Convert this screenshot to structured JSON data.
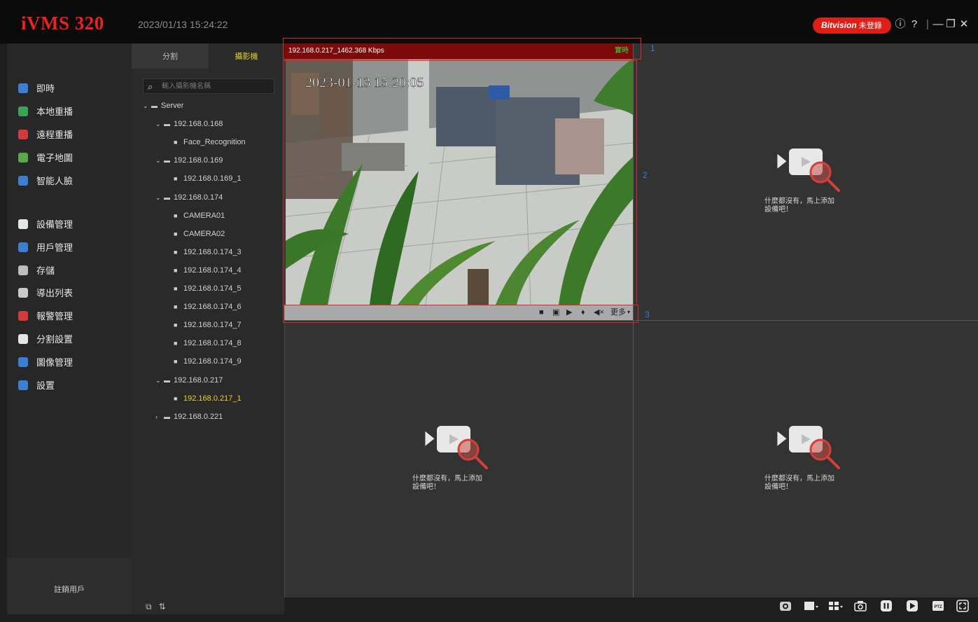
{
  "app": {
    "title": "iVMS 320",
    "datetime": "2023/01/13 15:24:22",
    "brand_badge": "Bitvision",
    "brand_status": "未登錄"
  },
  "nav": {
    "items": [
      {
        "label": "即時",
        "icon": "live-icon",
        "color": "#3c7fd0"
      },
      {
        "label": "本地重播",
        "icon": "local-playback-icon",
        "color": "#3aa35a"
      },
      {
        "label": "遠程重播",
        "icon": "remote-playback-icon",
        "color": "#d43a3a"
      },
      {
        "label": "電子地圖",
        "icon": "emap-icon",
        "color": "#5aa84a"
      },
      {
        "label": "智能人臉",
        "icon": "face-icon",
        "color": "#3c7fd0"
      },
      {
        "label": "設備管理",
        "icon": "device-icon",
        "color": "#e5e5e5"
      },
      {
        "label": "用戶管理",
        "icon": "user-icon",
        "color": "#3c7fd0"
      },
      {
        "label": "存儲",
        "icon": "storage-icon",
        "color": "#bdbdbd"
      },
      {
        "label": "導出列表",
        "icon": "export-icon",
        "color": "#c9c9c9"
      },
      {
        "label": "報警管理",
        "icon": "alarm-icon",
        "color": "#d43a3a"
      },
      {
        "label": "分割設置",
        "icon": "split-icon",
        "color": "#e5e5e5"
      },
      {
        "label": "圖像管理",
        "icon": "image-icon",
        "color": "#3c7fd0"
      },
      {
        "label": "設置",
        "icon": "settings-icon",
        "color": "#3c7fd0"
      }
    ],
    "logout": "註銷用戶"
  },
  "tree": {
    "tabs": [
      "分割",
      "攝影機"
    ],
    "search_placeholder": "輸入攝影機名稱",
    "nodes": [
      {
        "label": "Server",
        "level": 0,
        "type": "server",
        "arrow": "⌄"
      },
      {
        "label": "192.168.0.168",
        "level": 1,
        "type": "device",
        "arrow": "⌄"
      },
      {
        "label": "Face_Recognition",
        "level": 2,
        "type": "camera"
      },
      {
        "label": "192.168.0.169",
        "level": 1,
        "type": "device",
        "arrow": "⌄"
      },
      {
        "label": "192.168.0.169_1",
        "level": 2,
        "type": "camera"
      },
      {
        "label": "192.168.0.174",
        "level": 1,
        "type": "device",
        "arrow": "⌄"
      },
      {
        "label": "CAMERA01",
        "level": 2,
        "type": "camera"
      },
      {
        "label": "CAMERA02",
        "level": 2,
        "type": "camera"
      },
      {
        "label": "192.168.0.174_3",
        "level": 2,
        "type": "camera"
      },
      {
        "label": "192.168.0.174_4",
        "level": 2,
        "type": "camera"
      },
      {
        "label": "192.168.0.174_5",
        "level": 2,
        "type": "camera"
      },
      {
        "label": "192.168.0.174_6",
        "level": 2,
        "type": "camera"
      },
      {
        "label": "192.168.0.174_7",
        "level": 2,
        "type": "camera"
      },
      {
        "label": "192.168.0.174_8",
        "level": 2,
        "type": "camera"
      },
      {
        "label": "192.168.0.174_9",
        "level": 2,
        "type": "camera"
      },
      {
        "label": "192.168.0.217",
        "level": 1,
        "type": "device",
        "arrow": "⌄"
      },
      {
        "label": "192.168.0.217_1",
        "level": 2,
        "type": "camera",
        "selected": true
      },
      {
        "label": "192.168.0.221",
        "level": 1,
        "type": "device",
        "arrow": "›"
      }
    ]
  },
  "player": {
    "channel": "192.168.0.217_1",
    "bitrate": "462.368 Kbps",
    "mode": "實時",
    "osd_timestamp": "2023-01-13 15:20:05",
    "more": "更多",
    "annotations": [
      "1",
      "2",
      "3"
    ]
  },
  "empty_pane": {
    "line1": "什麼都沒有，馬上添加",
    "line2": "設備吧！"
  }
}
